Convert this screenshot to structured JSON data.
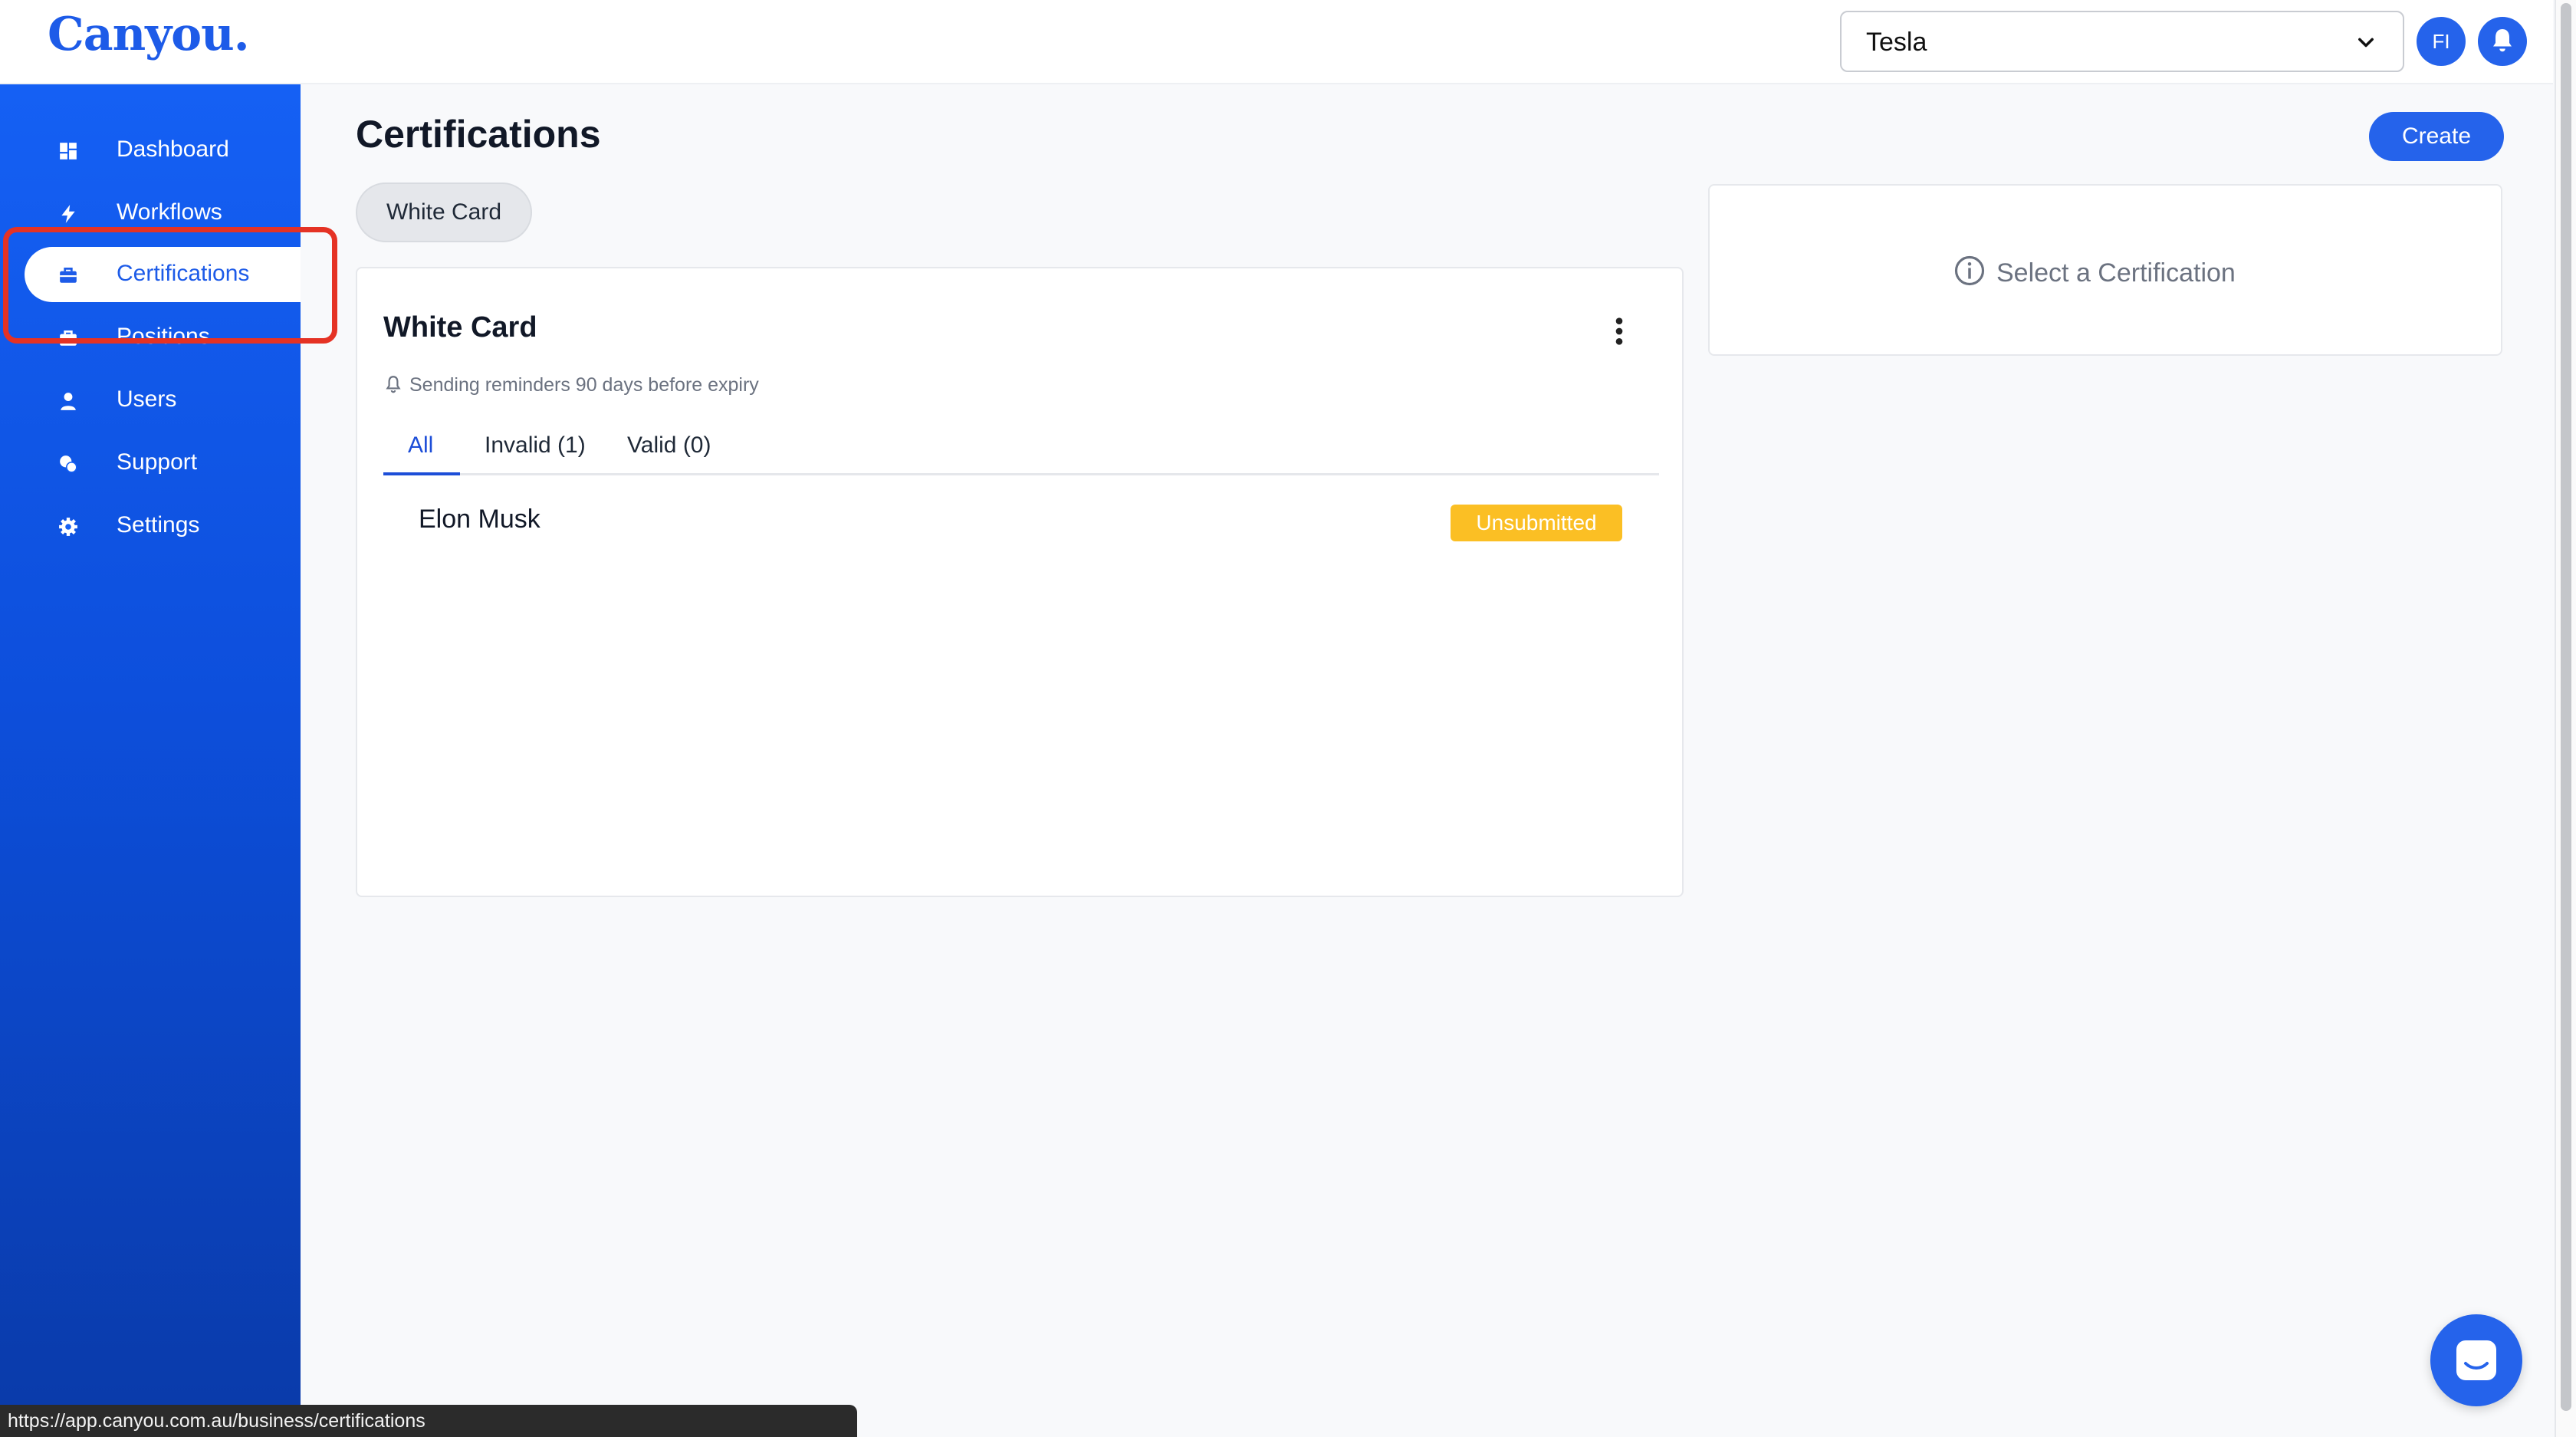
{
  "app": {
    "logo": "Canyou."
  },
  "topbar": {
    "company_select": {
      "value": "Tesla",
      "icon": "chevron-down-icon"
    },
    "avatar_initials": "FI",
    "notifications_icon": "bell-icon"
  },
  "sidebar": {
    "items": [
      {
        "label": "Dashboard",
        "icon": "dashboard-icon",
        "active": false
      },
      {
        "label": "Workflows",
        "icon": "lightning-icon",
        "active": false
      },
      {
        "label": "Certifications",
        "icon": "briefcase-icon",
        "active": true
      },
      {
        "label": "Positions",
        "icon": "briefcase-icon",
        "active": false
      },
      {
        "label": "Users",
        "icon": "user-icon",
        "active": false
      },
      {
        "label": "Support",
        "icon": "support-icon",
        "active": false
      },
      {
        "label": "Settings",
        "icon": "gear-icon",
        "active": false
      }
    ]
  },
  "main": {
    "title": "Certifications",
    "create_label": "Create",
    "filter_chip": "White Card",
    "card": {
      "title": "White Card",
      "reminder": "Sending reminders 90 days before expiry",
      "tabs": [
        {
          "label": "All",
          "active": true
        },
        {
          "label": "Invalid (1)",
          "active": false
        },
        {
          "label": "Valid (0)",
          "active": false
        }
      ],
      "rows": [
        {
          "name": "Elon Musk",
          "status": "Unsubmitted"
        }
      ]
    },
    "detail_panel": {
      "message": "Select a Certification",
      "icon": "info-icon"
    }
  },
  "status_bar": {
    "url": "https://app.canyou.com.au/business/certifications"
  },
  "colors": {
    "brand": "#1d5be8",
    "accent": "#2563eb",
    "badge_unsubmitted": "#fbbf24",
    "highlight": "#e53224"
  }
}
